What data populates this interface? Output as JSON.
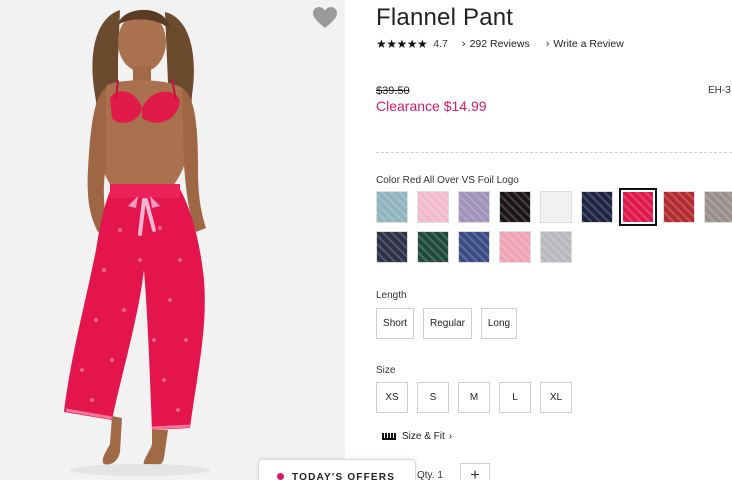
{
  "product": {
    "title": "Flannel Pant",
    "stars": "★★★★★",
    "rating": "4.7",
    "reviews_link": "292 Reviews",
    "write_review_link": "Write a Review",
    "original_price": "$39.50",
    "sale_price": "Clearance $14.99",
    "item_code": "EH-3"
  },
  "color": {
    "label": "Color Red All Over VS Foil Logo",
    "selected_index": 6,
    "swatches": [
      {
        "name": "teal-snakeskin",
        "color": "#8fb3bf"
      },
      {
        "name": "pink-marble",
        "color": "#f2b9cd"
      },
      {
        "name": "lavender-snakeskin",
        "color": "#9e92b8"
      },
      {
        "name": "black-red-print",
        "color": "#1a1418"
      },
      {
        "name": "white-black-logo",
        "color": "#f1efef"
      },
      {
        "name": "navy-gold-logo",
        "color": "#1d2340"
      },
      {
        "name": "red-foil-logo",
        "color": "#e0174a"
      },
      {
        "name": "red-plaid",
        "color": "#b22a2e"
      },
      {
        "name": "grey-red-plaid",
        "color": "#9a8f8c"
      },
      {
        "name": "navy-plaid",
        "color": "#2d3147"
      },
      {
        "name": "green-plaid",
        "color": "#1e4a3a"
      },
      {
        "name": "blue-floral",
        "color": "#3a4b86"
      },
      {
        "name": "pink-hearts",
        "color": "#f0a3b5"
      },
      {
        "name": "grey-floral",
        "color": "#b9b9bd"
      }
    ]
  },
  "length": {
    "label": "Length",
    "options": [
      "Short",
      "Regular",
      "Long"
    ]
  },
  "size": {
    "label": "Size",
    "options": [
      "XS",
      "S",
      "M",
      "L",
      "XL"
    ],
    "fit_link": "Size & Fit"
  },
  "offers": {
    "label": "TODAY'S OFFERS"
  },
  "quantity": {
    "label": "Qty. 1",
    "plus_symbol": "+"
  },
  "icons": {
    "favorite": "heart-icon",
    "size_fit": "ruler-icon",
    "chevron": "chevron-right-icon"
  }
}
